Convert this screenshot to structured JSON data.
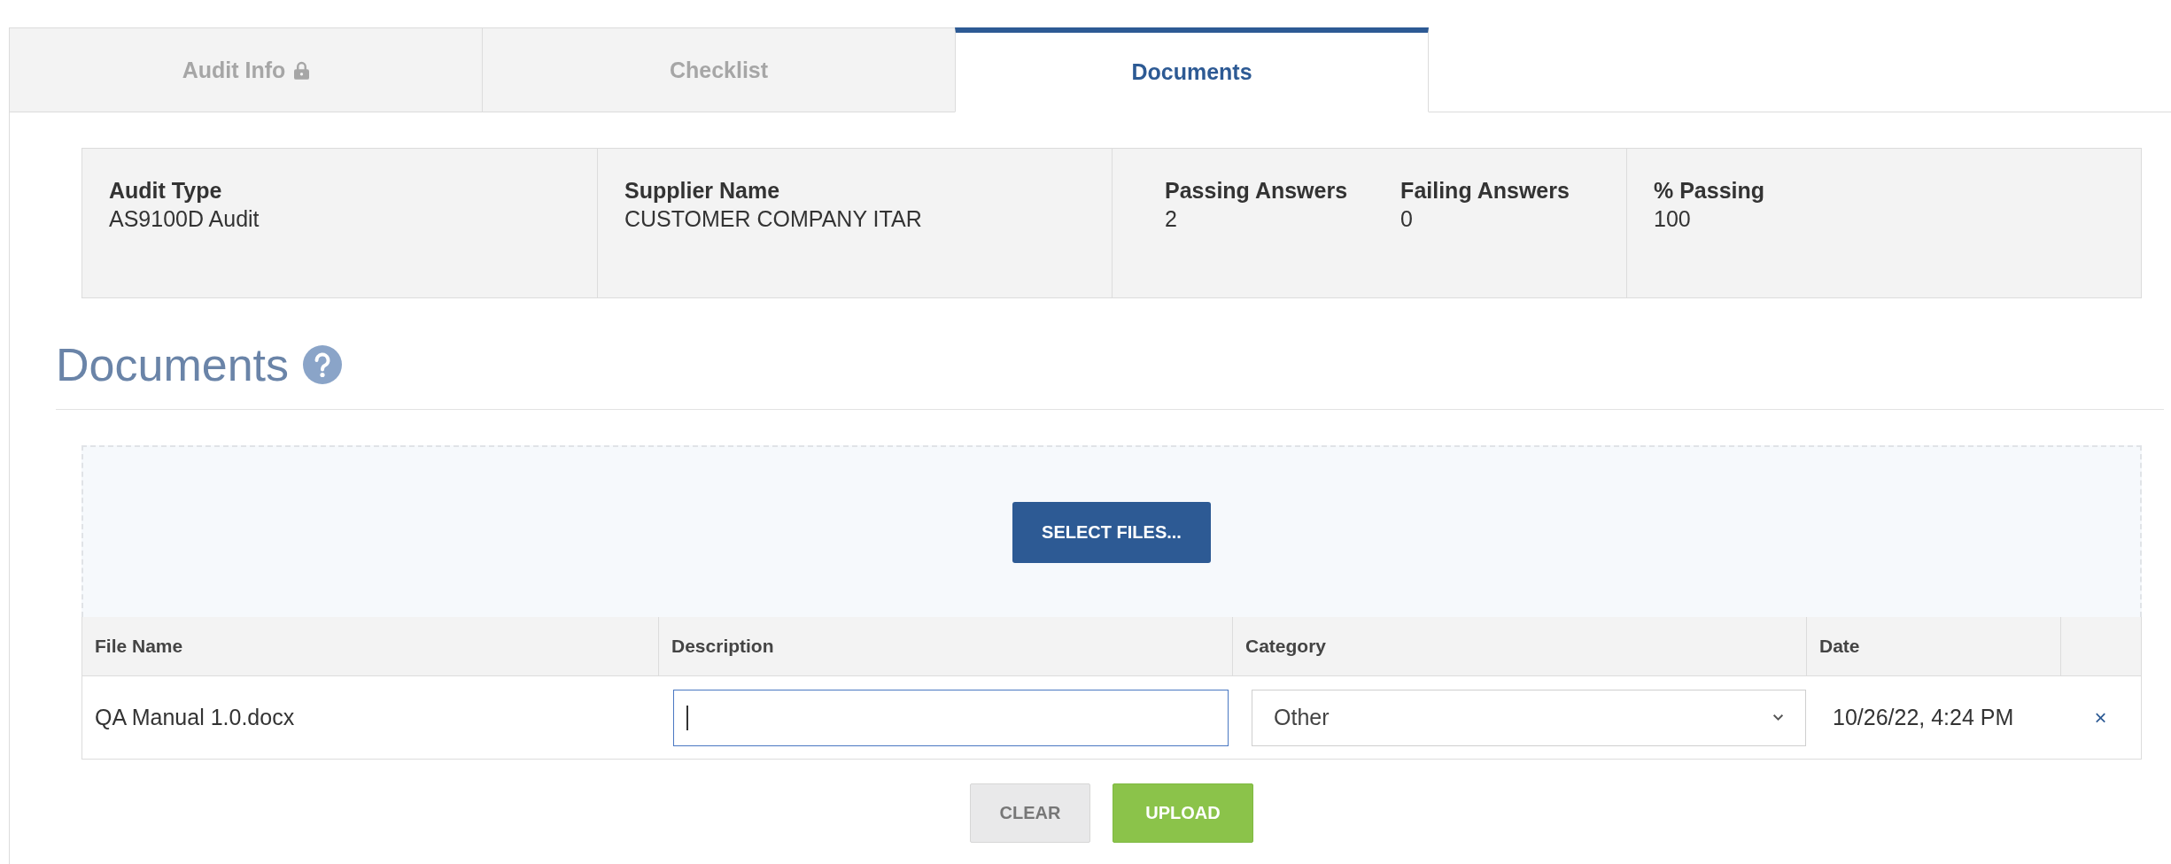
{
  "tabs": [
    {
      "label": "Audit Info",
      "locked": true,
      "selected": false
    },
    {
      "label": "Checklist",
      "locked": false,
      "selected": false
    },
    {
      "label": "Documents",
      "locked": false,
      "selected": true
    }
  ],
  "summary": [
    {
      "fields": [
        {
          "label": "Audit Type",
          "value": "AS9100D Audit"
        }
      ]
    },
    {
      "fields": [
        {
          "label": "Supplier Name",
          "value": "CUSTOMER COMPANY ITAR"
        }
      ]
    },
    {
      "fields": [
        {
          "label": "Passing Answers",
          "value": "2"
        },
        {
          "label": "Failing Answers",
          "value": "0"
        }
      ]
    },
    {
      "fields": [
        {
          "label": "% Passing",
          "value": "100"
        }
      ]
    }
  ],
  "section": {
    "title": "Documents"
  },
  "upload": {
    "select_button": "SELECT FILES...",
    "table": {
      "columns": [
        "File Name",
        "Description",
        "Category",
        "Date"
      ],
      "rows": [
        {
          "file_name": "QA Manual 1.0.docx",
          "description": {
            "focused": true
          },
          "category": "Other",
          "date": "10/26/22, 4:24 PM",
          "remove": "×"
        }
      ]
    },
    "actions": [
      {
        "label": "CLEAR",
        "kind": "clear"
      },
      {
        "label": "UPLOAD",
        "kind": "upload"
      }
    ]
  }
}
